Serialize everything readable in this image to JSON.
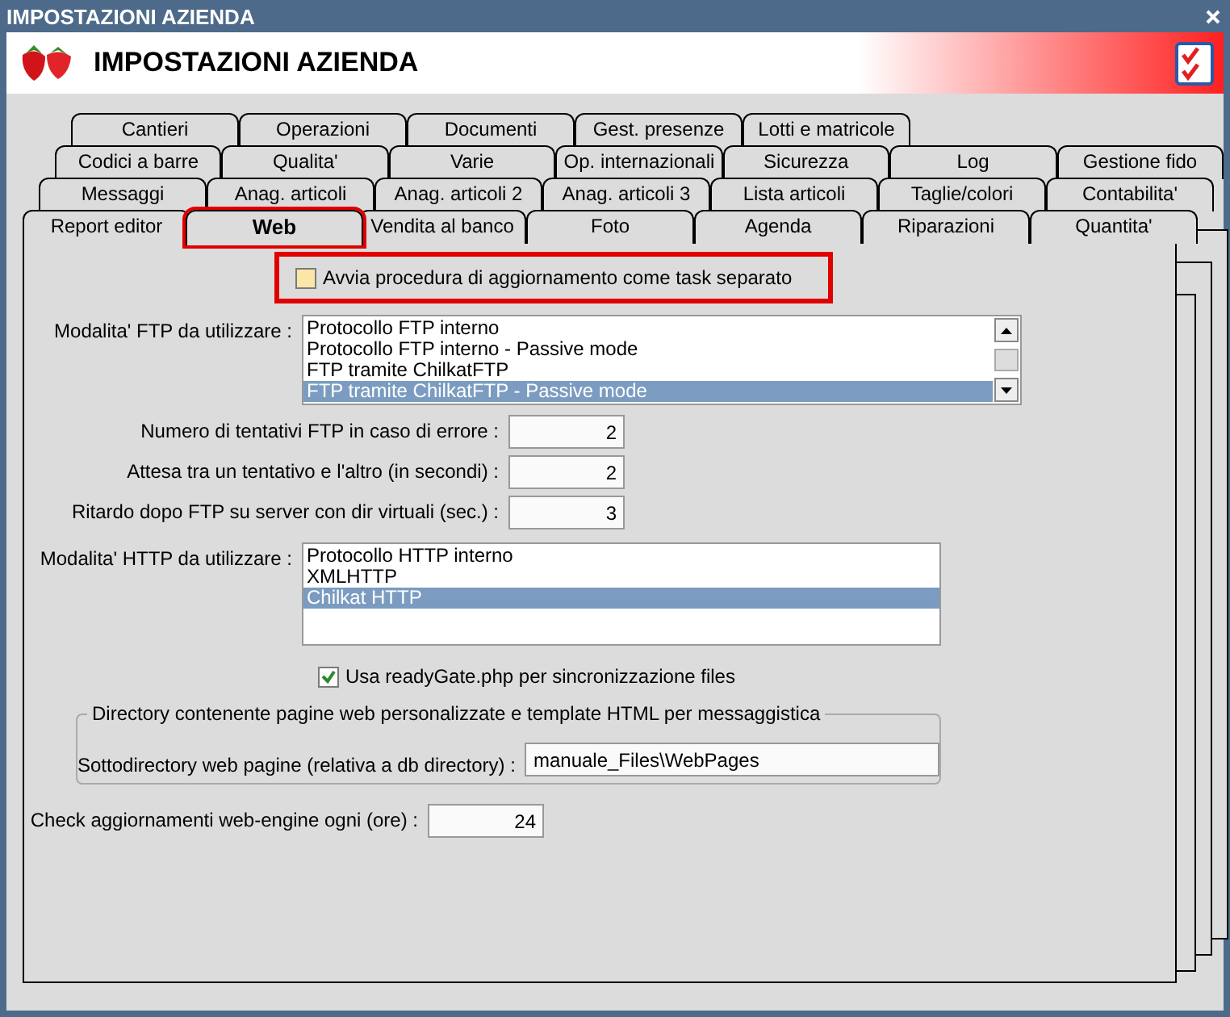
{
  "window": {
    "title": "IMPOSTAZIONI AZIENDA"
  },
  "header": {
    "title": "IMPOSTAZIONI AZIENDA"
  },
  "tab_rows": [
    [
      {
        "label": "Cantieri",
        "selected": false
      },
      {
        "label": "Operazioni",
        "selected": false
      },
      {
        "label": "Documenti",
        "selected": false
      },
      {
        "label": "Gest. presenze",
        "selected": false
      },
      {
        "label": "Lotti e matricole",
        "selected": false
      }
    ],
    [
      {
        "label": "Codici a barre",
        "selected": false
      },
      {
        "label": "Qualita'",
        "selected": false
      },
      {
        "label": "Varie",
        "selected": false
      },
      {
        "label": "Op. internazionali",
        "selected": false
      },
      {
        "label": "Sicurezza",
        "selected": false
      },
      {
        "label": "Log",
        "selected": false
      },
      {
        "label": "Gestione fido",
        "selected": false
      }
    ],
    [
      {
        "label": "Messaggi",
        "selected": false
      },
      {
        "label": "Anag. articoli",
        "selected": false
      },
      {
        "label": "Anag. articoli 2",
        "selected": false
      },
      {
        "label": "Anag. articoli 3",
        "selected": false
      },
      {
        "label": "Lista articoli",
        "selected": false
      },
      {
        "label": "Taglie/colori",
        "selected": false
      },
      {
        "label": "Contabilita'",
        "selected": false
      }
    ],
    [
      {
        "label": "Report editor",
        "selected": false
      },
      {
        "label": "Web",
        "selected": true
      },
      {
        "label": "Vendita al banco",
        "selected": false
      },
      {
        "label": "Foto",
        "selected": false
      },
      {
        "label": "Agenda",
        "selected": false
      },
      {
        "label": "Riparazioni",
        "selected": false
      },
      {
        "label": "Quantita'",
        "selected": false
      }
    ]
  ],
  "separate_task": {
    "label": "Avvia procedura di aggiornamento come task separato",
    "checked": false
  },
  "ftp_mode": {
    "label": "Modalita' FTP da utilizzare :",
    "options": [
      {
        "label": "Protocollo FTP interno",
        "selected": false
      },
      {
        "label": "Protocollo FTP interno - Passive mode",
        "selected": false
      },
      {
        "label": "FTP tramite ChilkatFTP",
        "selected": false
      },
      {
        "label": "FTP tramite ChilkatFTP - Passive mode",
        "selected": true
      }
    ]
  },
  "numeric_fields": [
    {
      "label": "Numero di tentativi FTP in caso di errore :",
      "value": "2"
    },
    {
      "label": "Attesa tra un tentativo e l'altro (in secondi) :",
      "value": "2"
    },
    {
      "label": "Ritardo dopo FTP su server con dir virtuali (sec.) :",
      "value": "3"
    }
  ],
  "http_mode": {
    "label": "Modalita' HTTP da utilizzare :",
    "options": [
      {
        "label": "Protocollo HTTP interno",
        "selected": false
      },
      {
        "label": "XMLHTTP",
        "selected": false
      },
      {
        "label": "Chilkat HTTP",
        "selected": true
      }
    ]
  },
  "readygate": {
    "label": "Usa readyGate.php per sincronizzazione files",
    "checked": true
  },
  "directory_group": {
    "title": "Directory contenente pagine web personalizzate e template HTML per messaggistica",
    "label": "Sottodirectory web pagine (relativa a db directory) :",
    "value": "manuale_Files\\WebPages"
  },
  "check_updates": {
    "label": "Check aggiornamenti web-engine ogni (ore) :",
    "value": "24"
  }
}
